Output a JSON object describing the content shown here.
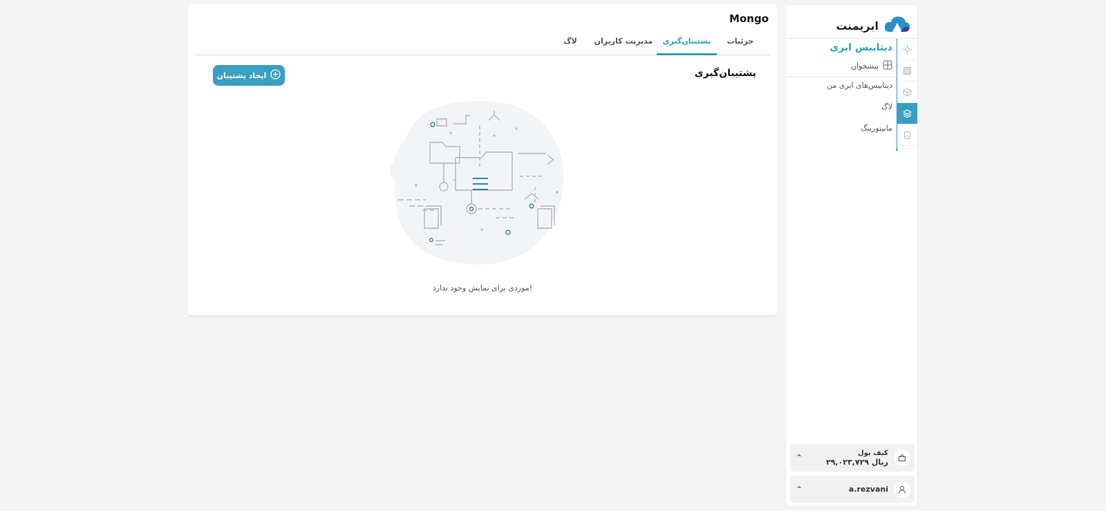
{
  "brand": {
    "name": "ابریمنت"
  },
  "sidebar": {
    "section_title": "دیتابیس ابری",
    "items": [
      {
        "label": "پیشخوان",
        "icon": "dashboard-icon"
      },
      {
        "label": "دیتابیس‌های ابری من"
      },
      {
        "label": "لاگ"
      },
      {
        "label": "مانیتورینگ"
      }
    ],
    "rail_icons": [
      "network-icon",
      "server-icon",
      "box-icon",
      "layers-icon",
      "database-icon"
    ],
    "wallet": {
      "label": "کیف پول",
      "value": "۲۹,۰۲۳,۷۲۹ ریال"
    },
    "user": {
      "name": "a.rezvani"
    }
  },
  "main": {
    "db_title": "Mongo",
    "tabs": [
      {
        "label": "جزئیات",
        "active": false
      },
      {
        "label": "پشتیبان‌گیری",
        "active": true
      },
      {
        "label": "مدیریت کاربران",
        "active": false
      },
      {
        "label": "لاگ",
        "active": false
      }
    ],
    "content_title": "پشتیبان‌گیری",
    "create_button": "ایجاد پشتیبان",
    "empty_message": "موردی برای نمایش وجود ندارد!"
  },
  "colors": {
    "accent": "#3a9fc0",
    "background": "#f4f4f4"
  }
}
